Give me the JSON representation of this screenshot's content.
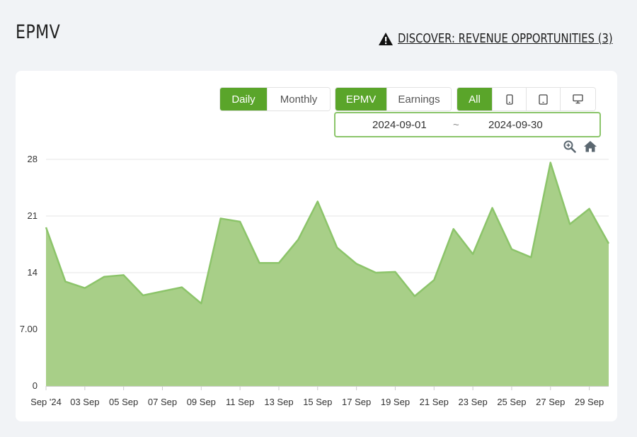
{
  "header": {
    "title": "EPMV",
    "discover_label": "DISCOVER: REVENUE OPPORTUNITIES (3)"
  },
  "controls": {
    "granularity": [
      {
        "label": "Daily",
        "active": true
      },
      {
        "label": "Monthly",
        "active": false
      }
    ],
    "metric": [
      {
        "label": "EPMV",
        "active": true
      },
      {
        "label": "Earnings",
        "active": false
      }
    ],
    "device": [
      {
        "label": "All",
        "icon": "all",
        "active": true
      },
      {
        "label": "",
        "icon": "mobile-icon",
        "active": false
      },
      {
        "label": "",
        "icon": "tablet-icon",
        "active": false
      },
      {
        "label": "",
        "icon": "desktop-icon",
        "active": false
      }
    ],
    "date_start": "2024-09-01",
    "date_separator": "~",
    "date_end": "2024-09-30",
    "tools": [
      "zoom-icon",
      "home-icon"
    ]
  },
  "colors": {
    "accent": "#5aa52a",
    "area_fill": "#a8cf88",
    "area_line": "#8cc46a"
  },
  "chart_data": {
    "type": "area",
    "title": "",
    "xlabel": "",
    "ylabel": "",
    "grid": true,
    "ylim": [
      0,
      28
    ],
    "y_ticks": [
      "0",
      "7.00",
      "14",
      "21",
      "28"
    ],
    "y_tick_values": [
      0,
      7,
      14,
      21,
      28
    ],
    "x_tick_labels": [
      "Sep '24",
      "03 Sep",
      "05 Sep",
      "07 Sep",
      "09 Sep",
      "11 Sep",
      "13 Sep",
      "15 Sep",
      "17 Sep",
      "19 Sep",
      "21 Sep",
      "23 Sep",
      "25 Sep",
      "27 Sep",
      "29 Sep"
    ],
    "x": [
      "2024-09-01",
      "2024-09-02",
      "2024-09-03",
      "2024-09-04",
      "2024-09-05",
      "2024-09-06",
      "2024-09-07",
      "2024-09-08",
      "2024-09-09",
      "2024-09-10",
      "2024-09-11",
      "2024-09-12",
      "2024-09-13",
      "2024-09-14",
      "2024-09-15",
      "2024-09-16",
      "2024-09-17",
      "2024-09-18",
      "2024-09-19",
      "2024-09-20",
      "2024-09-21",
      "2024-09-22",
      "2024-09-23",
      "2024-09-24",
      "2024-09-25",
      "2024-09-26",
      "2024-09-27",
      "2024-09-28",
      "2024-09-29",
      "2024-09-30"
    ],
    "series": [
      {
        "name": "EPMV",
        "values": [
          19.6,
          12.9,
          12.1,
          13.5,
          13.7,
          11.2,
          11.7,
          12.2,
          10.2,
          20.7,
          20.3,
          15.2,
          15.2,
          18.1,
          22.8,
          17.1,
          15.1,
          14.0,
          14.1,
          11.1,
          13.1,
          19.4,
          16.3,
          22.0,
          16.9,
          15.9,
          27.6,
          20.0,
          21.9,
          17.6
        ]
      }
    ]
  }
}
